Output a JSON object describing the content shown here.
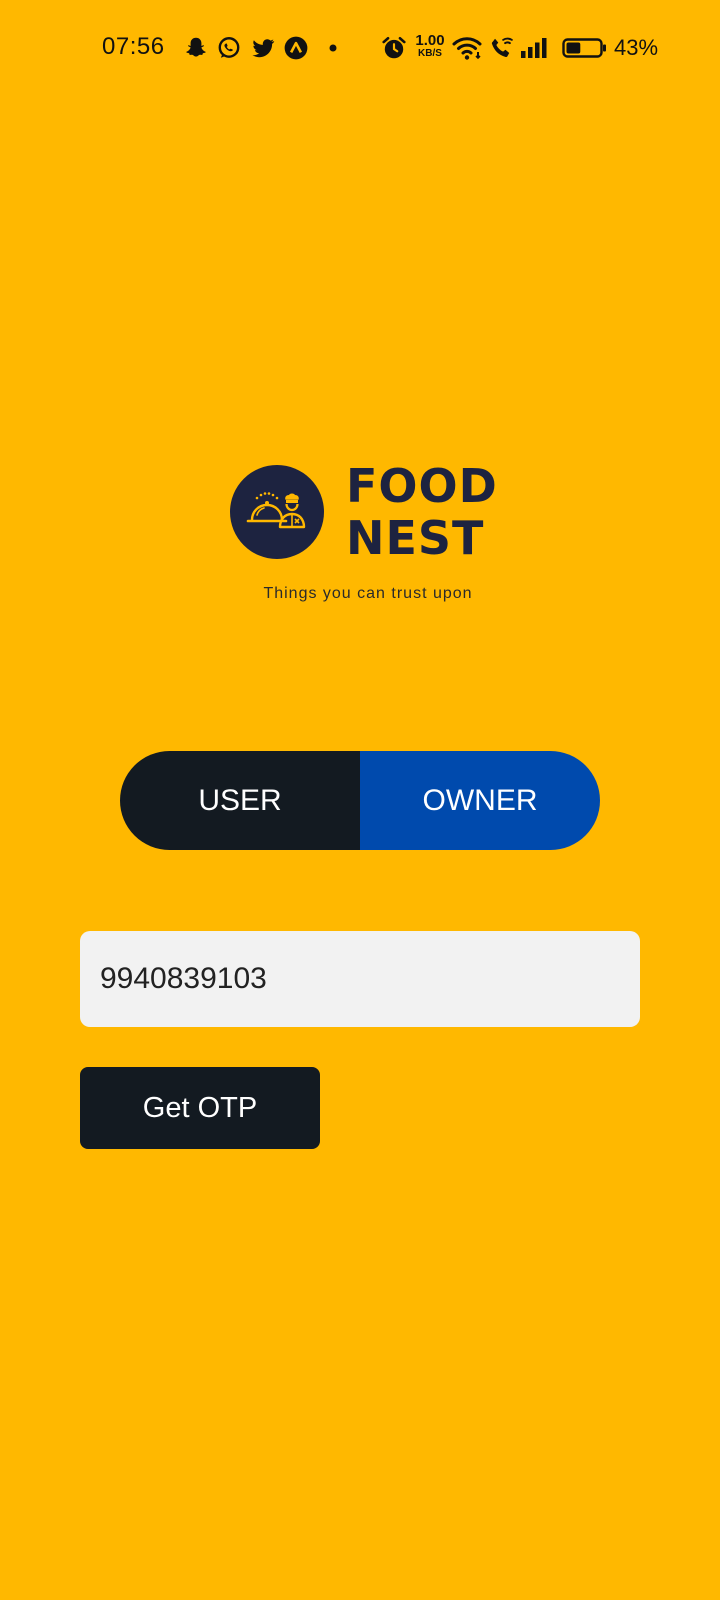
{
  "status_bar": {
    "time": "07:56",
    "net_speed_value": "1.00",
    "net_speed_unit": "KB/S",
    "battery_percent": "43%",
    "notification_icons": [
      "snapchat-icon",
      "whatsapp-icon",
      "twitter-icon",
      "app-launcher-icon",
      "more-dot-icon"
    ],
    "system_icons": [
      "alarm-icon",
      "wifi-icon",
      "wifi-call-icon",
      "signal-icon",
      "battery-icon"
    ],
    "battery_level": 0.43
  },
  "brand": {
    "name_line1": "FOOD",
    "name_line2": "NEST",
    "tagline": "Things you can trust upon",
    "logo_icon": "chef-cloche-icon",
    "colors": {
      "navy": "#1D2340",
      "gold": "#FFB800"
    }
  },
  "role_toggle": {
    "options": [
      {
        "label": "USER",
        "color": "#131A21"
      },
      {
        "label": "OWNER",
        "color": "#004AAD"
      }
    ]
  },
  "phone_input": {
    "value": "9940839103"
  },
  "actions": {
    "get_otp_label": "Get OTP"
  },
  "theme": {
    "background": "#FFB800",
    "dark": "#131A21",
    "blue": "#004AAD",
    "input_bg": "#F2F2F2"
  }
}
